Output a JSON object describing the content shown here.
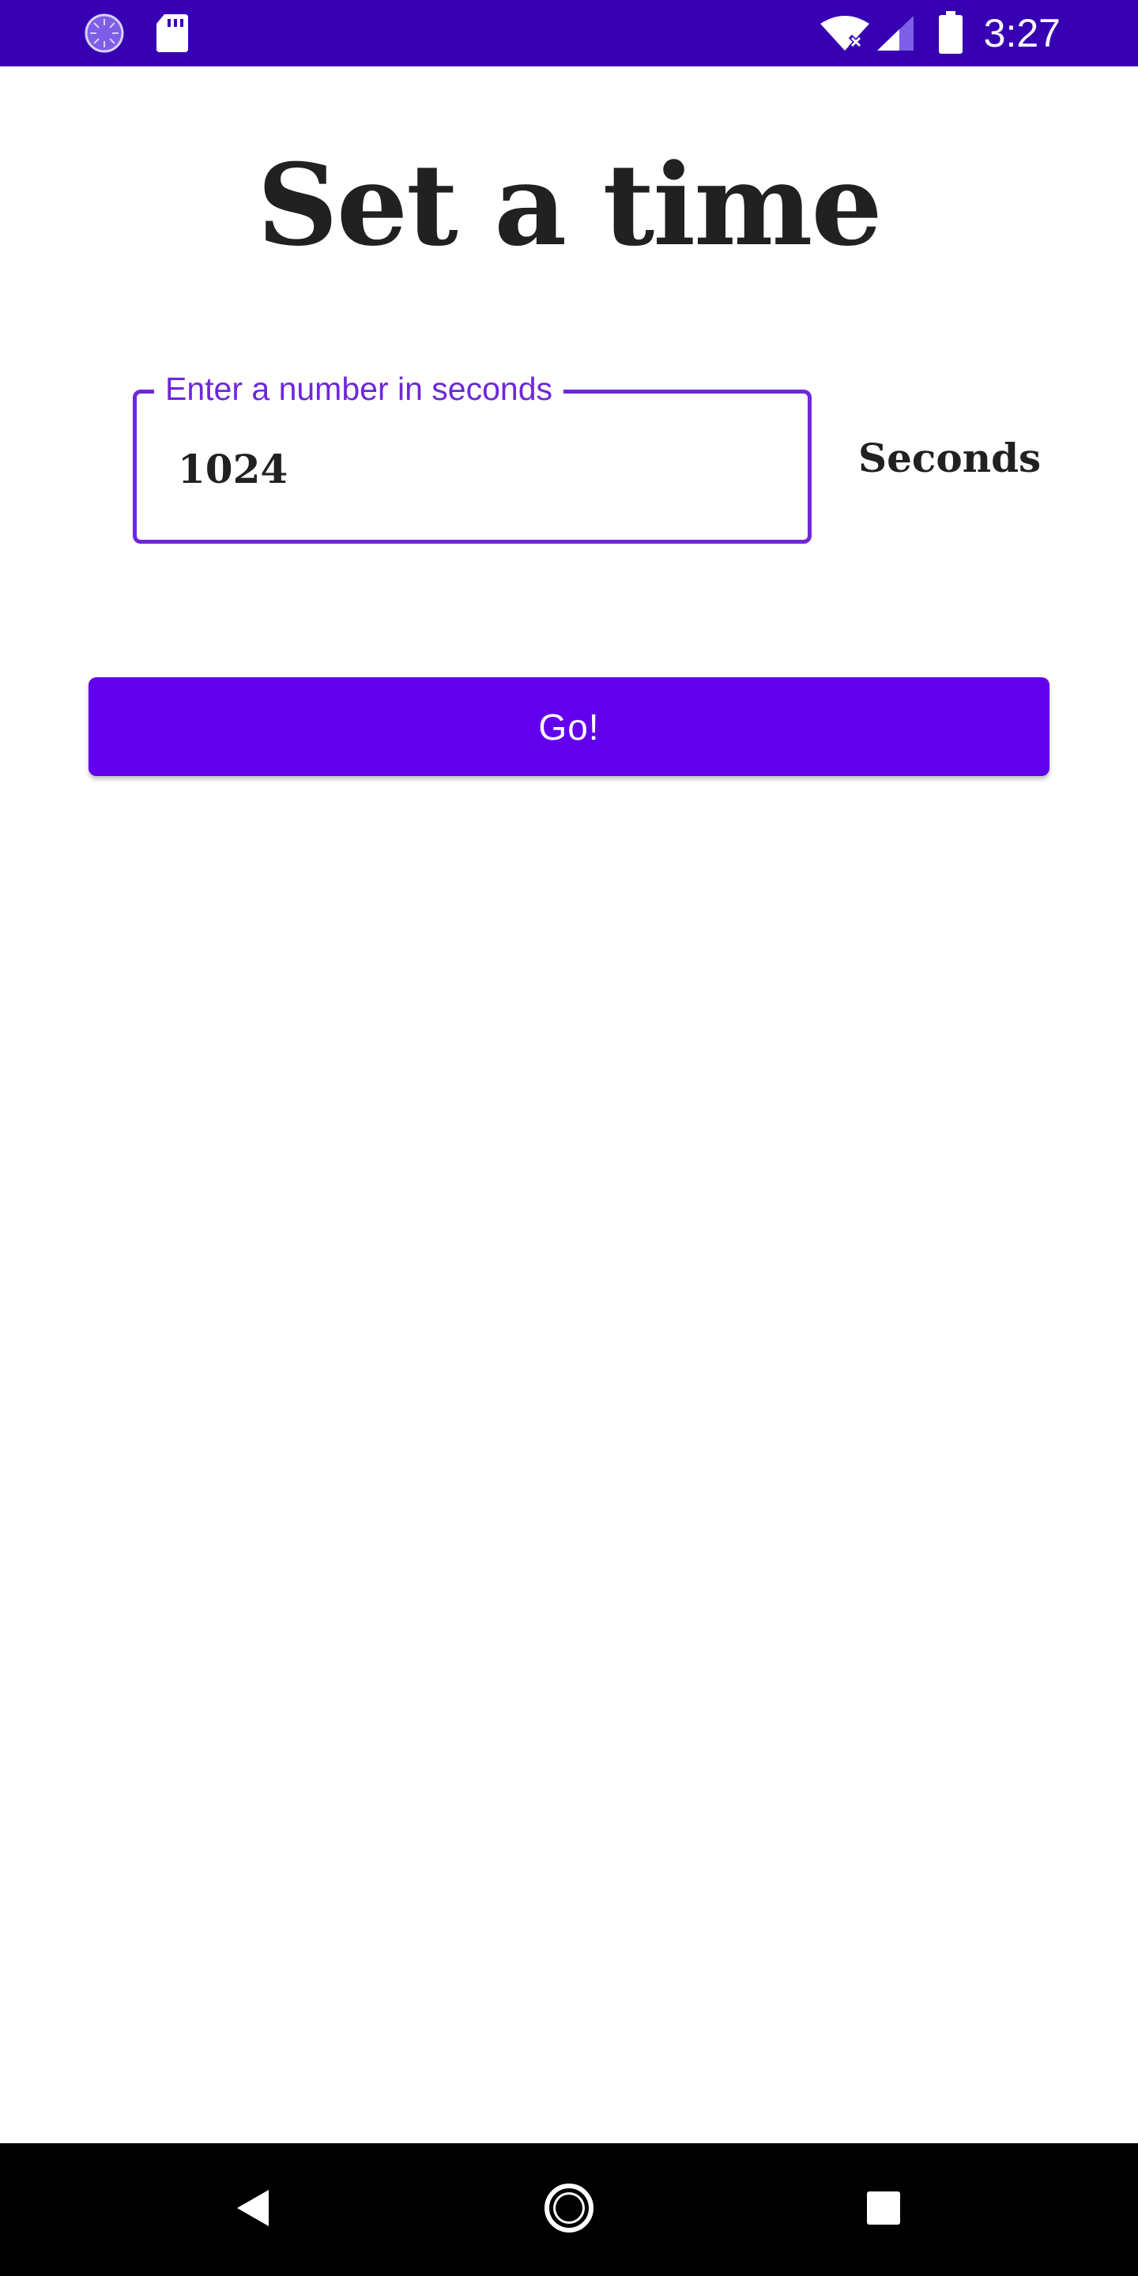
{
  "status_bar": {
    "time": "3:27",
    "background": "#3700B3",
    "left_icons": [
      "loading-circle-icon",
      "sd-card-icon"
    ],
    "right_icons": [
      "wifi-off-icon",
      "cell-signal-icon",
      "battery-icon"
    ]
  },
  "screen": {
    "title": "Set a time"
  },
  "time_input": {
    "label": "Enter a number in seconds",
    "value": "1024",
    "unit_label": "Seconds",
    "accent_color": "#6D28D9"
  },
  "go_button": {
    "label": "Go!",
    "color": "#6200EE"
  },
  "nav_bar": {
    "buttons": [
      "back-icon",
      "home-icon",
      "recents-icon"
    ]
  }
}
